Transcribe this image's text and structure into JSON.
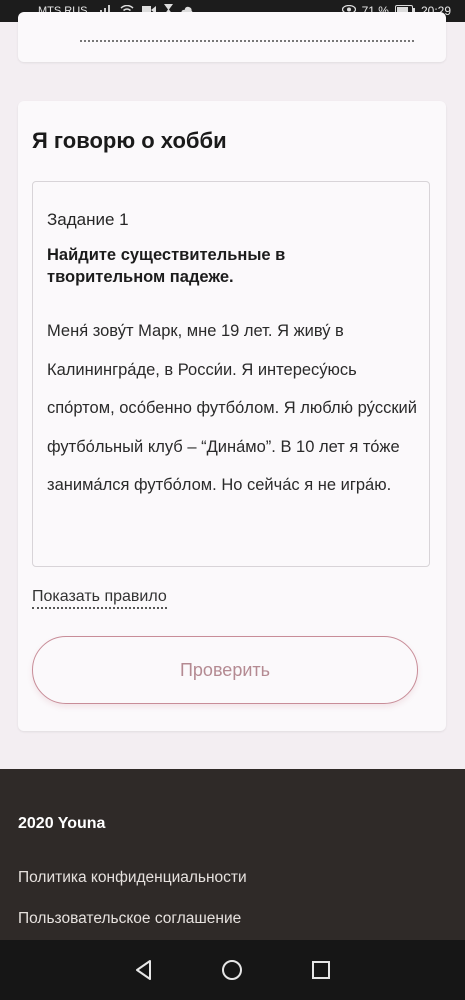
{
  "status_bar": {
    "carrier": "MTS RUS",
    "battery": "71 %",
    "time": "20:29"
  },
  "card": {
    "title": "Я говорю о хобби",
    "task": {
      "number": "Задание 1",
      "instruction": "Найдите существительные в творительном падеже.",
      "text": "Меня́ зову́т Марк, мне 19 лет. Я живу́ в Калинингра́де, в Росси́и. Я интересу́юсь спо́ртом, осо́бенно футбо́лом. Я люблю́ ру́сский футбо́льный клуб – “Дина́мо”. В 10 лет я то́же занима́лся футбо́лом. Но сейча́с я не игра́ю."
    },
    "rule_link": "Показать правило",
    "check_button": "Проверить"
  },
  "footer": {
    "brand": "2020 Youna",
    "links": [
      "Политика конфиденциальности",
      "Пользовательское соглашение"
    ]
  },
  "colors": {
    "background": "#f3eef2",
    "card": "#fbf9fb",
    "button_border": "#c88d98",
    "button_text": "#b48a92",
    "footer": "#2f2a28",
    "navbar": "#161616"
  }
}
